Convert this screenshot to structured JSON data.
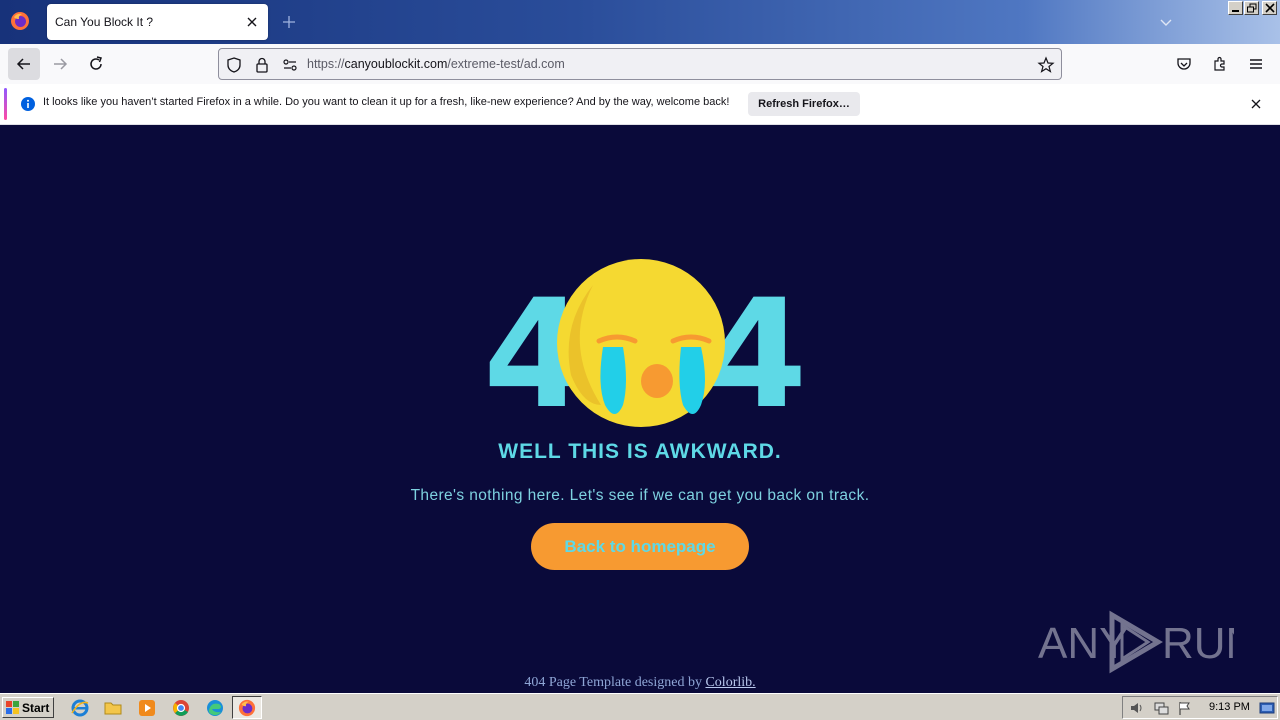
{
  "browser": {
    "tab_title": "Can You Block It ?",
    "url_prefix": "https://",
    "url_host": "canyoublockit.com",
    "url_path": "/extreme-test/ad.com"
  },
  "notification": {
    "message": "It looks like you haven’t started Firefox in a while. Do you want to clean it up for a fresh, like-new experience? And by the way, welcome back!",
    "button_label": "Refresh Firefox…"
  },
  "page": {
    "digit_left": "4",
    "digit_right": "4",
    "heading": "WELL THIS IS AWKWARD.",
    "subtext": "There's nothing here. Let's see if we can get you back on track.",
    "button_label": "Back to homepage",
    "footer_text": "404 Page Template designed by ",
    "footer_link": "Colorlib."
  },
  "watermark": {
    "left": "ANY",
    "right": "RUN"
  },
  "taskbar": {
    "start_label": "Start",
    "clock": "9:13 PM"
  },
  "colors": {
    "page_bg": "#0a0a3a",
    "accent_cyan": "#5ed9e6",
    "button_orange": "#f79a31",
    "emoji_yellow": "#f5d931"
  }
}
